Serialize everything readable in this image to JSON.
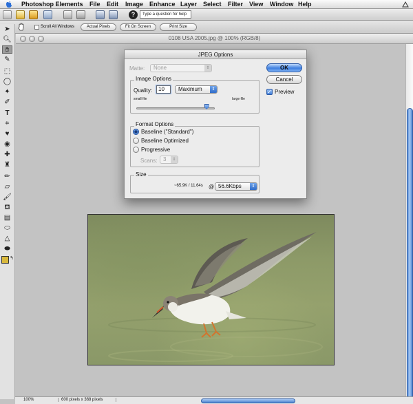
{
  "menubar": {
    "app_name": "Photoshop Elements",
    "items": [
      "File",
      "Edit",
      "Image",
      "Enhance",
      "Layer",
      "Select",
      "Filter",
      "View",
      "Window",
      "Help"
    ]
  },
  "shortcuts": {
    "help_placeholder": "Type a question for help",
    "help_icon": "?"
  },
  "options_bar": {
    "scroll_all_label": "Scroll All Windows",
    "actual_pixels_label": "Actual Pixels",
    "fit_on_screen_label": "Fit On Screen",
    "print_size_label": "Print Size"
  },
  "document": {
    "title": "0108 USA 2005.jpg @ 100% (RGB/8)"
  },
  "status_bar": {
    "zoom": "100%",
    "dimensions": "600 pixels x 368 pixels"
  },
  "colors": {
    "accent": "#3f80e0",
    "foreground_color": "#d8b83c",
    "background_color": "#ffffff"
  },
  "jpeg_dialog": {
    "title": "JPEG Options",
    "matte_label": "Matte:",
    "matte_value": "None",
    "image_options_label": "Image Options",
    "quality_label": "Quality:",
    "quality_value": "10",
    "quality_preset": "Maximum",
    "small_file_label": "small file",
    "large_file_label": "large file",
    "quality_fraction": 0.9,
    "format_options_label": "Format Options",
    "format_baseline": "Baseline (\"Standard\")",
    "format_optimized": "Baseline Optimized",
    "format_progressive": "Progressive",
    "scans_label": "Scans:",
    "scans_value": "3",
    "size_label": "Size",
    "size_value": "~65.9K / 11.64s",
    "at_symbol": "@",
    "connection_speed": "56.6Kbps",
    "ok_label": "OK",
    "cancel_label": "Cancel",
    "preview_label": "Preview",
    "preview_checked": true
  },
  "tools": [
    "move-tool-icon",
    "zoom-tool-icon",
    "hand-tool-icon",
    "eyedropper-tool-icon",
    "marquee-tool-icon",
    "lasso-tool-icon",
    "magic-wand-tool-icon",
    "selection-brush-icon",
    "type-tool-icon",
    "crop-tool-icon",
    "cookie-cutter-icon",
    "red-eye-tool-icon",
    "healing-brush-icon",
    "clone-stamp-icon",
    "pencil-tool-icon",
    "eraser-tool-icon",
    "brush-tool-icon",
    "paint-bucket-icon",
    "gradient-tool-icon",
    "shape-tool-icon",
    "blur-tool-icon",
    "sponge-tool-icon"
  ]
}
